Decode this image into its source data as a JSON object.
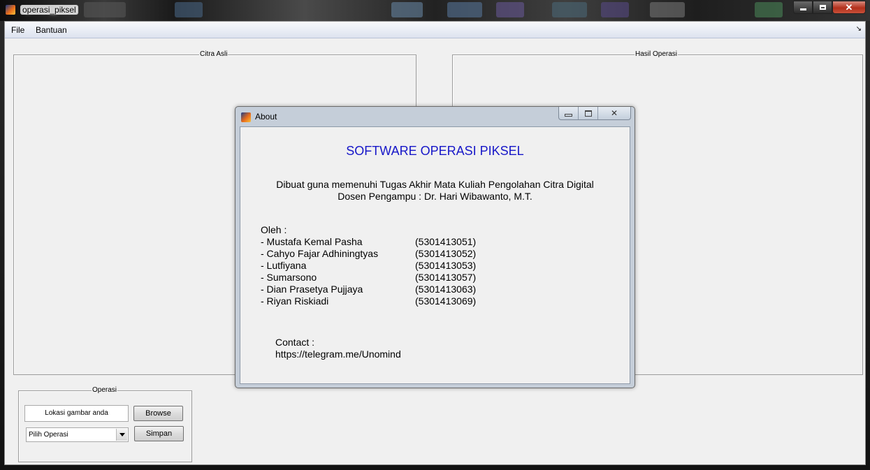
{
  "window": {
    "title": "operasi_piksel"
  },
  "menu": {
    "file": "File",
    "bantuan": "Bantuan",
    "dock_glyph": "↘"
  },
  "panels": {
    "citra_asli": "Citra Asli",
    "hasil_operasi": "Hasil Operasi",
    "operasi": "Operasi"
  },
  "operasi": {
    "path_field": "Lokasi gambar anda",
    "browse_button": "Browse",
    "select_value": "Pilih Operasi",
    "simpan_button": "Simpan"
  },
  "about": {
    "title": "About",
    "heading": "SOFTWARE OPERASI PIKSEL",
    "description_line1": "Dibuat guna memenuhi Tugas Akhir Mata Kuliah Pengolahan Citra Digital",
    "description_line2": "Dosen Pengampu : Dr. Hari Wibawanto, M.T.",
    "by_label": "Oleh :",
    "members": [
      {
        "name": "- Mustafa Kemal Pasha",
        "nim": "(5301413051)"
      },
      {
        "name": "- Cahyo Fajar Adhiningtyas",
        "nim": "(5301413052)"
      },
      {
        "name": "- Lutfiyana",
        "nim": "(5301413053)"
      },
      {
        "name": "- Sumarsono",
        "nim": "(5301413057)"
      },
      {
        "name": "- Dian Prasetya Pujjaya",
        "nim": "(5301413063)"
      },
      {
        "name": "- Riyan Riskiadi",
        "nim": "(5301413069)"
      }
    ],
    "contact_label": "Contact :",
    "contact_url": "https://telegram.me/Unomind"
  },
  "colors": {
    "heading": "#1616c8",
    "client_bg": "#f0f0f0",
    "close_button": "#b2301c"
  },
  "icons": {
    "app": "matlab-icon",
    "minimize": "minimize-icon",
    "maximize": "maximize-icon",
    "close": "close-icon",
    "dropdown": "chevron-down-icon"
  }
}
